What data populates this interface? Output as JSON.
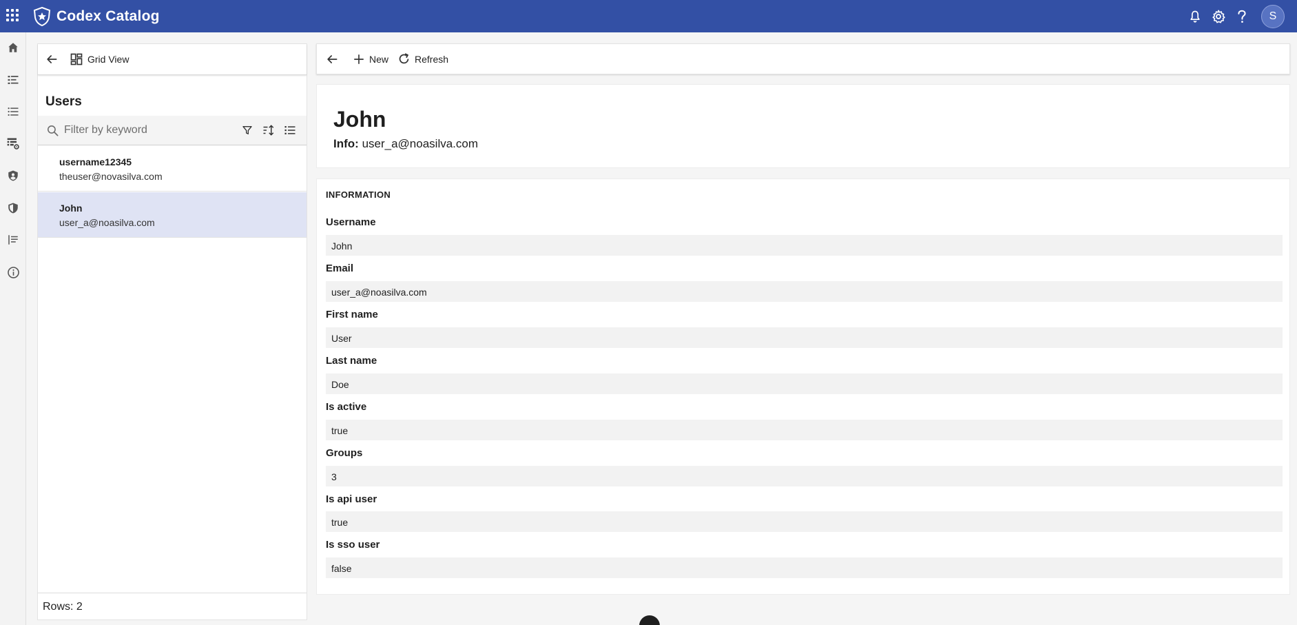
{
  "app": {
    "title": "Codex Catalog",
    "avatar_initial": "S"
  },
  "icons": {
    "apps": "apps-grid-icon",
    "logo": "shield-star-logo",
    "notifications": "bell-icon",
    "settings": "gear-icon",
    "help": "help-icon"
  },
  "colors": {
    "topbar": "#3350a5",
    "selected_row": "#dfe3f4",
    "field_bg": "#f2f2f2"
  },
  "rail": [
    "home-icon",
    "list-detail-icon",
    "list-icon",
    "table-settings-icon",
    "user-shield-icon",
    "shield-icon",
    "list-lines-icon",
    "info-icon"
  ],
  "left_toolbar": {
    "grid_view_label": "Grid View"
  },
  "list": {
    "title": "Users",
    "filter_placeholder": "Filter by keyword",
    "rows": [
      {
        "name": "username12345",
        "email": "theuser@novasilva.com"
      },
      {
        "name": "John",
        "email": "user_a@noasilva.com"
      }
    ],
    "rows_count": "Rows: 2"
  },
  "right_toolbar": {
    "new_label": "New",
    "refresh_label": "Refresh"
  },
  "detail": {
    "title": "John",
    "info_label": "Info:",
    "info_value": "user_a@noasilva.com",
    "section_title": "INFORMATION",
    "fields": [
      {
        "label": "Username",
        "value": "John"
      },
      {
        "label": "Email",
        "value": "user_a@noasilva.com"
      },
      {
        "label": "First name",
        "value": "User"
      },
      {
        "label": "Last name",
        "value": "Doe"
      },
      {
        "label": "Is active",
        "value": "true"
      },
      {
        "label": "Groups",
        "value": "3"
      },
      {
        "label": "Is api user",
        "value": "true"
      },
      {
        "label": "Is sso user",
        "value": "false"
      }
    ]
  }
}
